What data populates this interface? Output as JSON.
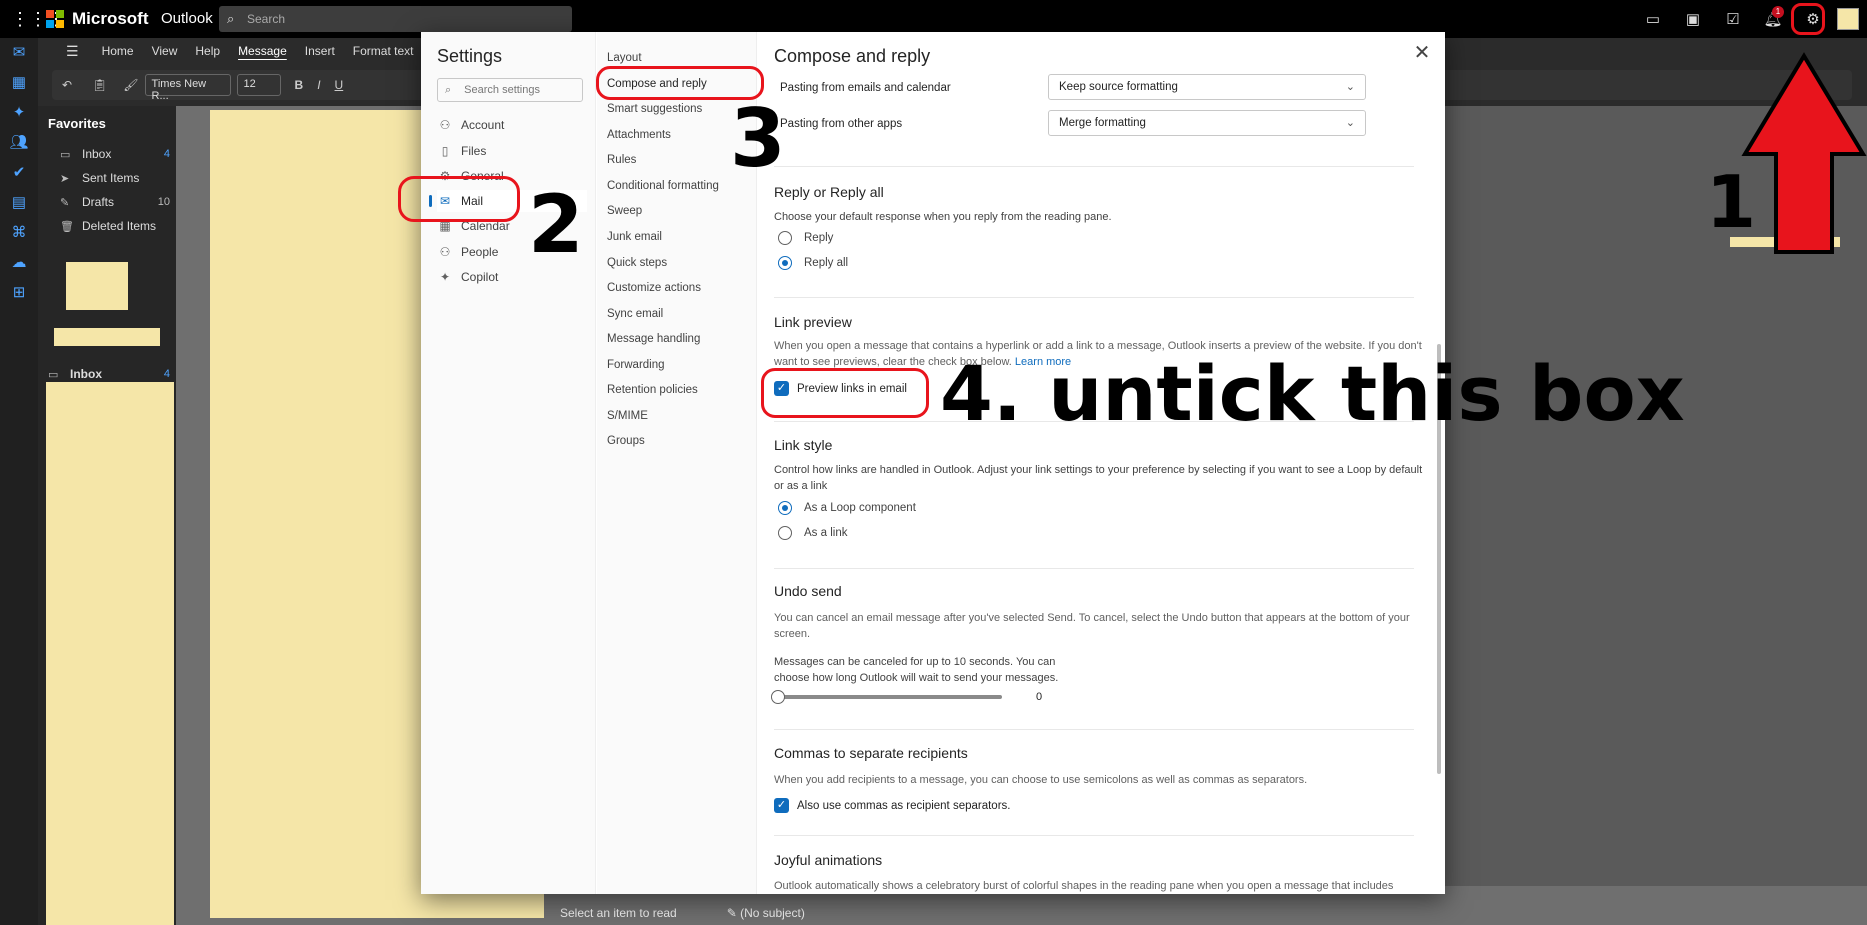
{
  "topbar": {
    "brand": "Microsoft",
    "app": "Outlook",
    "search_placeholder": "Search",
    "notification_count": "1"
  },
  "ribbon": {
    "tabs": [
      "Home",
      "View",
      "Help",
      "Message",
      "Insert",
      "Format text"
    ],
    "active_tab": "Message",
    "font_name": "Times New R...",
    "font_size": "12"
  },
  "folders": {
    "favorites_label": "Favorites",
    "items": [
      {
        "label": "Inbox",
        "count": "4"
      },
      {
        "label": "Sent Items",
        "count": ""
      },
      {
        "label": "Drafts",
        "count": "10"
      },
      {
        "label": "Deleted Items",
        "count": ""
      }
    ],
    "inbox_group_label": "Inbox",
    "inbox_group_count": "4"
  },
  "bottombar": {
    "select_item": "Select an item to read",
    "draft_label": "(No subject)"
  },
  "settings": {
    "title": "Settings",
    "search_placeholder": "Search settings",
    "nav": [
      "Account",
      "Files",
      "General",
      "Mail",
      "Calendar",
      "People",
      "Copilot"
    ],
    "selected_nav": "Mail",
    "subnav": [
      "Layout",
      "Compose and reply",
      "Smart suggestions",
      "Attachments",
      "Rules",
      "Conditional formatting",
      "Sweep",
      "Junk email",
      "Quick steps",
      "Customize actions",
      "Sync email",
      "Message handling",
      "Forwarding",
      "Retention policies",
      "S/MIME",
      "Groups"
    ],
    "selected_subnav": "Compose and reply"
  },
  "content": {
    "title": "Compose and reply",
    "paste_emails_label": "Pasting from emails and calendar",
    "paste_emails_value": "Keep source formatting",
    "paste_apps_label": "Pasting from other apps",
    "paste_apps_value": "Merge formatting",
    "reply": {
      "title": "Reply or Reply all",
      "desc": "Choose your default response when you reply from the reading pane.",
      "opt1": "Reply",
      "opt2": "Reply all",
      "selected": "Reply all"
    },
    "link_preview": {
      "title": "Link preview",
      "desc": "When you open a message that contains a hyperlink or add a link to a message, Outlook inserts a preview of the website. If you don't want to see previews, clear the check box below.",
      "learn_more": "Learn more",
      "checkbox": "Preview links in email",
      "checked": true
    },
    "link_style": {
      "title": "Link style",
      "desc": "Control how links are handled in Outlook. Adjust your link settings to your preference by selecting if you want to see a Loop by default or as a link",
      "opt1": "As a Loop component",
      "opt2": "As a link",
      "selected": "As a Loop component"
    },
    "undo": {
      "title": "Undo send",
      "desc": "You can cancel an email message after you've selected Send. To cancel, select the Undo button that appears at the bottom of your screen.",
      "desc2": "Messages can be canceled for up to 10 seconds. You can choose how long Outlook will wait to send your messages.",
      "value": "0"
    },
    "commas": {
      "title": "Commas to separate recipients",
      "desc": "When you add recipients to a message, you can choose to use semicolons as well as commas as separators.",
      "checkbox": "Also use commas as recipient separators.",
      "checked": true
    },
    "joyful": {
      "title": "Joyful animations",
      "desc": "Outlook automatically shows a celebratory burst of colorful shapes in the reading pane when you open a message that includes"
    }
  },
  "annotations": {
    "step1": "1",
    "step2": "2",
    "step3": "3",
    "step4": "4. untick this box",
    "color": "#e8141c"
  }
}
